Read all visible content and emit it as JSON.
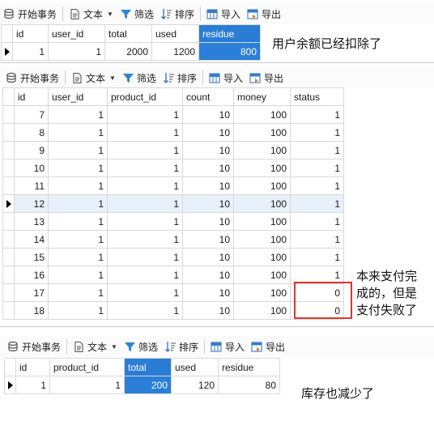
{
  "toolbar": {
    "begin": "开始事务",
    "text": "文本",
    "filter": "筛选",
    "sort": "排序",
    "import": "导入",
    "export": "导出"
  },
  "account": {
    "columns": [
      "id",
      "user_id",
      "total",
      "used",
      "residue"
    ],
    "rows": [
      [
        "1",
        "1",
        "2000",
        "1200",
        "800"
      ]
    ],
    "note": "用户余额已经扣除了"
  },
  "orders": {
    "columns": [
      "id",
      "user_id",
      "product_id",
      "count",
      "money",
      "status"
    ],
    "rows": [
      [
        "7",
        "1",
        "1",
        "10",
        "100",
        "1"
      ],
      [
        "8",
        "1",
        "1",
        "10",
        "100",
        "1"
      ],
      [
        "9",
        "1",
        "1",
        "10",
        "100",
        "1"
      ],
      [
        "10",
        "1",
        "1",
        "10",
        "100",
        "1"
      ],
      [
        "11",
        "1",
        "1",
        "10",
        "100",
        "1"
      ],
      [
        "12",
        "1",
        "1",
        "10",
        "100",
        "1"
      ],
      [
        "13",
        "1",
        "1",
        "10",
        "100",
        "1"
      ],
      [
        "14",
        "1",
        "1",
        "10",
        "100",
        "1"
      ],
      [
        "15",
        "1",
        "1",
        "10",
        "100",
        "1"
      ],
      [
        "16",
        "1",
        "1",
        "10",
        "100",
        "1"
      ],
      [
        "17",
        "1",
        "1",
        "10",
        "100",
        "0"
      ],
      [
        "18",
        "1",
        "1",
        "10",
        "100",
        "0"
      ]
    ],
    "current_row": 5,
    "note_lines": [
      "本来支付完",
      "成的，但是",
      "支付失败了"
    ]
  },
  "storage": {
    "columns": [
      "id",
      "product_id",
      "total",
      "used",
      "residue"
    ],
    "rows": [
      [
        "1",
        "1",
        "200",
        "120",
        "80"
      ]
    ],
    "note": "库存也减少了"
  },
  "colors": {
    "selection": "#2b7fd8",
    "highlight_box": "#e0342d",
    "current_row": "#e8f0fb"
  }
}
